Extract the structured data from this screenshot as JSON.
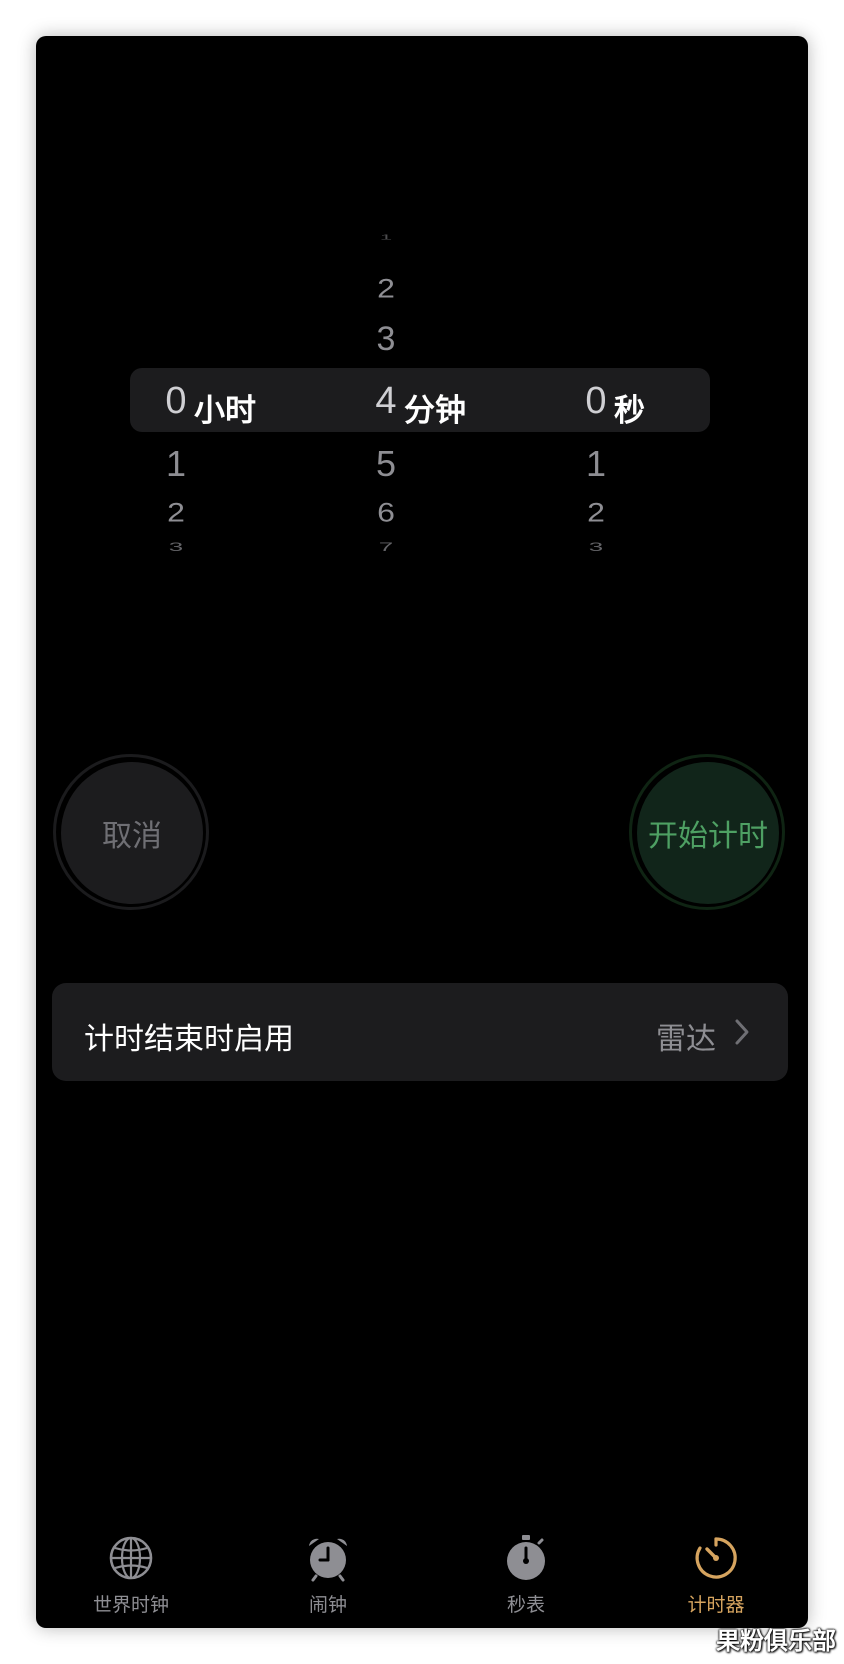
{
  "picker": {
    "hours": {
      "above": [
        "",
        "",
        ""
      ],
      "selected": "0",
      "unit": "小时",
      "below": [
        "1",
        "2",
        "3"
      ]
    },
    "minutes": {
      "above": [
        "1",
        "2",
        "3"
      ],
      "selected": "4",
      "unit": "分钟",
      "below": [
        "5",
        "6",
        "7"
      ]
    },
    "seconds": {
      "above": [
        "",
        "",
        ""
      ],
      "selected": "0",
      "unit": "秒",
      "below": [
        "1",
        "2",
        "3"
      ]
    }
  },
  "buttons": {
    "cancel_label": "取消",
    "start_label": "开始计时"
  },
  "setting": {
    "label": "计时结束时启用",
    "value": "雷达"
  },
  "tabs": [
    {
      "label": "世界时钟",
      "icon": "globe-icon",
      "active": false
    },
    {
      "label": "闹钟",
      "icon": "alarm-clock-icon",
      "active": false
    },
    {
      "label": "秒表",
      "icon": "stopwatch-icon",
      "active": false
    },
    {
      "label": "计时器",
      "icon": "timer-icon",
      "active": true
    }
  ],
  "colors": {
    "accent": "#d6a45f",
    "start_button_text": "#4ea063",
    "inactive": "#8e8e93"
  },
  "watermark": "果粉俱乐部"
}
